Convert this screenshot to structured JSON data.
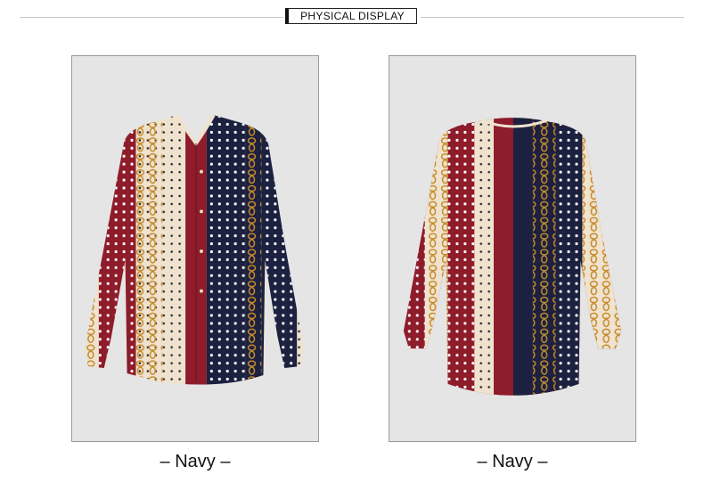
{
  "section_title": "PHYSICAL DISPLAY",
  "views": [
    {
      "caption": "– Navy –",
      "view": "front",
      "image": "blouse-front-photo"
    },
    {
      "caption": "– Navy –",
      "view": "back",
      "image": "blouse-back-photo"
    }
  ],
  "colors": {
    "panel_bg": "#e5e5e5",
    "wine_red": "#8e1c2b",
    "navy": "#1c2140",
    "cream": "#efe3cf",
    "chain_gold": "#c58a2a"
  }
}
